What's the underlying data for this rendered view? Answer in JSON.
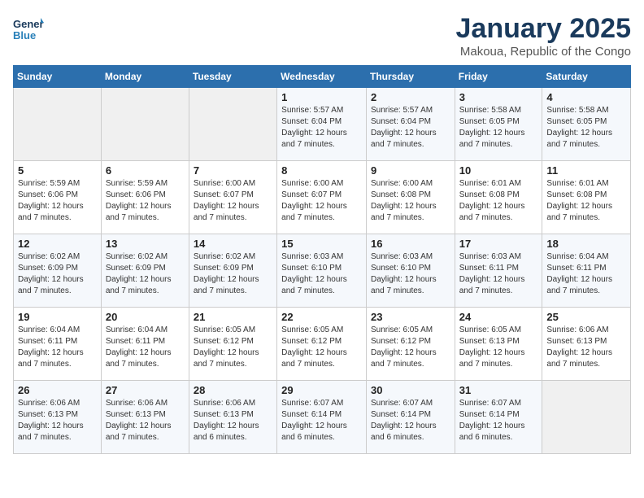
{
  "logo": {
    "line1": "General",
    "line2": "Blue"
  },
  "title": "January 2025",
  "subtitle": "Makoua, Republic of the Congo",
  "weekdays": [
    "Sunday",
    "Monday",
    "Tuesday",
    "Wednesday",
    "Thursday",
    "Friday",
    "Saturday"
  ],
  "weeks": [
    [
      {
        "day": "",
        "info": ""
      },
      {
        "day": "",
        "info": ""
      },
      {
        "day": "",
        "info": ""
      },
      {
        "day": "1",
        "info": "Sunrise: 5:57 AM\nSunset: 6:04 PM\nDaylight: 12 hours\nand 7 minutes."
      },
      {
        "day": "2",
        "info": "Sunrise: 5:57 AM\nSunset: 6:04 PM\nDaylight: 12 hours\nand 7 minutes."
      },
      {
        "day": "3",
        "info": "Sunrise: 5:58 AM\nSunset: 6:05 PM\nDaylight: 12 hours\nand 7 minutes."
      },
      {
        "day": "4",
        "info": "Sunrise: 5:58 AM\nSunset: 6:05 PM\nDaylight: 12 hours\nand 7 minutes."
      }
    ],
    [
      {
        "day": "5",
        "info": "Sunrise: 5:59 AM\nSunset: 6:06 PM\nDaylight: 12 hours\nand 7 minutes."
      },
      {
        "day": "6",
        "info": "Sunrise: 5:59 AM\nSunset: 6:06 PM\nDaylight: 12 hours\nand 7 minutes."
      },
      {
        "day": "7",
        "info": "Sunrise: 6:00 AM\nSunset: 6:07 PM\nDaylight: 12 hours\nand 7 minutes."
      },
      {
        "day": "8",
        "info": "Sunrise: 6:00 AM\nSunset: 6:07 PM\nDaylight: 12 hours\nand 7 minutes."
      },
      {
        "day": "9",
        "info": "Sunrise: 6:00 AM\nSunset: 6:08 PM\nDaylight: 12 hours\nand 7 minutes."
      },
      {
        "day": "10",
        "info": "Sunrise: 6:01 AM\nSunset: 6:08 PM\nDaylight: 12 hours\nand 7 minutes."
      },
      {
        "day": "11",
        "info": "Sunrise: 6:01 AM\nSunset: 6:08 PM\nDaylight: 12 hours\nand 7 minutes."
      }
    ],
    [
      {
        "day": "12",
        "info": "Sunrise: 6:02 AM\nSunset: 6:09 PM\nDaylight: 12 hours\nand 7 minutes."
      },
      {
        "day": "13",
        "info": "Sunrise: 6:02 AM\nSunset: 6:09 PM\nDaylight: 12 hours\nand 7 minutes."
      },
      {
        "day": "14",
        "info": "Sunrise: 6:02 AM\nSunset: 6:09 PM\nDaylight: 12 hours\nand 7 minutes."
      },
      {
        "day": "15",
        "info": "Sunrise: 6:03 AM\nSunset: 6:10 PM\nDaylight: 12 hours\nand 7 minutes."
      },
      {
        "day": "16",
        "info": "Sunrise: 6:03 AM\nSunset: 6:10 PM\nDaylight: 12 hours\nand 7 minutes."
      },
      {
        "day": "17",
        "info": "Sunrise: 6:03 AM\nSunset: 6:11 PM\nDaylight: 12 hours\nand 7 minutes."
      },
      {
        "day": "18",
        "info": "Sunrise: 6:04 AM\nSunset: 6:11 PM\nDaylight: 12 hours\nand 7 minutes."
      }
    ],
    [
      {
        "day": "19",
        "info": "Sunrise: 6:04 AM\nSunset: 6:11 PM\nDaylight: 12 hours\nand 7 minutes."
      },
      {
        "day": "20",
        "info": "Sunrise: 6:04 AM\nSunset: 6:11 PM\nDaylight: 12 hours\nand 7 minutes."
      },
      {
        "day": "21",
        "info": "Sunrise: 6:05 AM\nSunset: 6:12 PM\nDaylight: 12 hours\nand 7 minutes."
      },
      {
        "day": "22",
        "info": "Sunrise: 6:05 AM\nSunset: 6:12 PM\nDaylight: 12 hours\nand 7 minutes."
      },
      {
        "day": "23",
        "info": "Sunrise: 6:05 AM\nSunset: 6:12 PM\nDaylight: 12 hours\nand 7 minutes."
      },
      {
        "day": "24",
        "info": "Sunrise: 6:05 AM\nSunset: 6:13 PM\nDaylight: 12 hours\nand 7 minutes."
      },
      {
        "day": "25",
        "info": "Sunrise: 6:06 AM\nSunset: 6:13 PM\nDaylight: 12 hours\nand 7 minutes."
      }
    ],
    [
      {
        "day": "26",
        "info": "Sunrise: 6:06 AM\nSunset: 6:13 PM\nDaylight: 12 hours\nand 7 minutes."
      },
      {
        "day": "27",
        "info": "Sunrise: 6:06 AM\nSunset: 6:13 PM\nDaylight: 12 hours\nand 7 minutes."
      },
      {
        "day": "28",
        "info": "Sunrise: 6:06 AM\nSunset: 6:13 PM\nDaylight: 12 hours\nand 6 minutes."
      },
      {
        "day": "29",
        "info": "Sunrise: 6:07 AM\nSunset: 6:14 PM\nDaylight: 12 hours\nand 6 minutes."
      },
      {
        "day": "30",
        "info": "Sunrise: 6:07 AM\nSunset: 6:14 PM\nDaylight: 12 hours\nand 6 minutes."
      },
      {
        "day": "31",
        "info": "Sunrise: 6:07 AM\nSunset: 6:14 PM\nDaylight: 12 hours\nand 6 minutes."
      },
      {
        "day": "",
        "info": ""
      }
    ]
  ]
}
